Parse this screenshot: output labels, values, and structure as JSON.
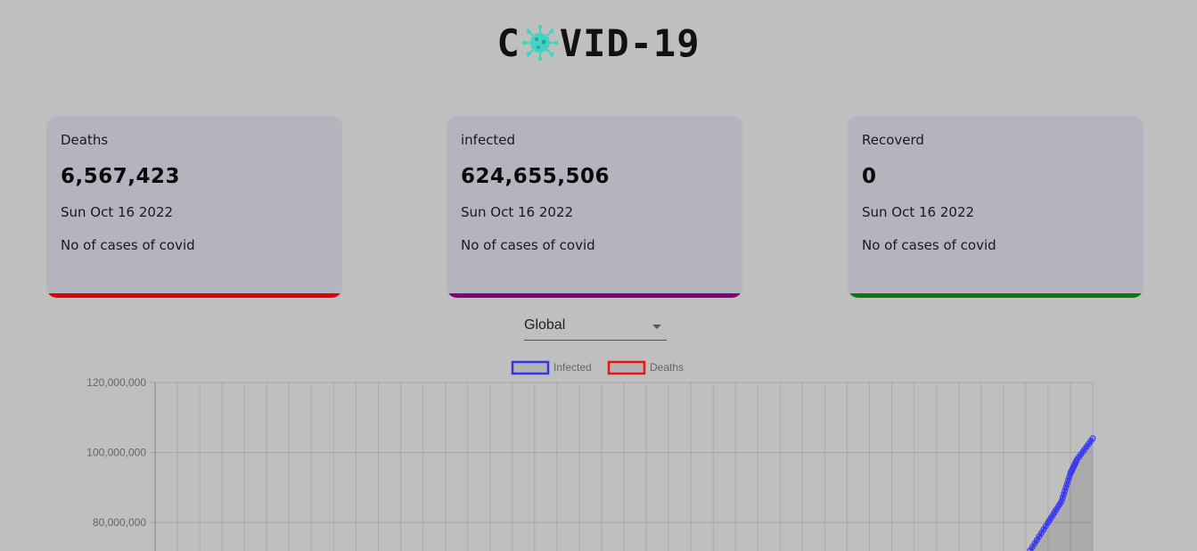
{
  "header": {
    "title_left": "C",
    "title_right": "VID-19",
    "logo_icon": "virus-icon"
  },
  "cards": [
    {
      "title": "Deaths",
      "value": "6,567,423",
      "date": "Sun Oct 16 2022",
      "desc": "No of cases of covid",
      "accent": "#e00000"
    },
    {
      "title": "infected",
      "value": "624,655,506",
      "date": "Sun Oct 16 2022",
      "desc": "No of cases of covid",
      "accent": "#800080"
    },
    {
      "title": "Recoverd",
      "value": "0",
      "date": "Sun Oct 16 2022",
      "desc": "No of cases of covid",
      "accent": "#0a7a0a"
    }
  ],
  "country_select": {
    "value": "Global"
  },
  "chart_data": {
    "type": "line",
    "legend_position": "top",
    "grid": true,
    "ylim": [
      60000000,
      120000000
    ],
    "yticks": [
      "120,000,000",
      "100,000,000",
      "80,000,000"
    ],
    "num_x_points": 43,
    "series": [
      {
        "name": "Infected",
        "color": "#3333ee",
        "fill": "rgba(0,0,0,0.1)",
        "points": [
          [
            40.2,
            72000000
          ],
          [
            41.0,
            80000000
          ],
          [
            41.6,
            86000000
          ],
          [
            42.0,
            94000000
          ],
          [
            42.3,
            98000000
          ],
          [
            43.0,
            104000000
          ]
        ]
      },
      {
        "name": "Deaths",
        "color": "#ee1111",
        "fill": "rgba(0,0,0,0.1)",
        "points": []
      }
    ]
  }
}
